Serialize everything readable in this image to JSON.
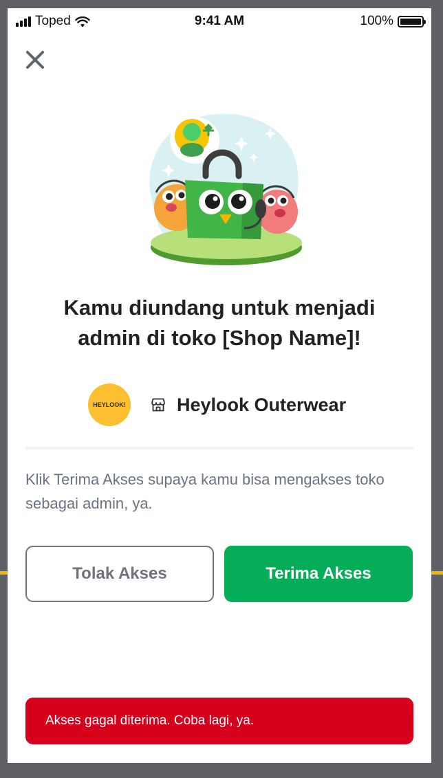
{
  "status_bar": {
    "carrier": "Toped",
    "time": "9:41 AM",
    "battery": "100%"
  },
  "icons": {
    "close": "close-icon",
    "signal": "signal-icon",
    "wifi": "wifi-icon",
    "battery": "battery-icon",
    "store": "store-icon",
    "illustration": "invite-admin-illustration"
  },
  "invite": {
    "title_line1": "Kamu diundang untuk menjadi",
    "title_line2": "admin di toko [Shop Name]!",
    "shop_logo_text": "HEYLOOK!",
    "shop_name": "Heylook Outerwear",
    "description": "Klik Terima Akses supaya kamu bisa mengakses toko sebagai admin, ya."
  },
  "actions": {
    "reject_label": "Tolak Akses",
    "accept_label": "Terima Akses"
  },
  "toast": {
    "message": "Akses gagal diterima. Coba lagi, ya."
  },
  "colors": {
    "primary_green": "#06ad59",
    "error_red": "#d7001c",
    "shop_logo_yellow": "#fcbf2f",
    "text_dark": "#1f2124",
    "text_muted": "#6a7382"
  }
}
